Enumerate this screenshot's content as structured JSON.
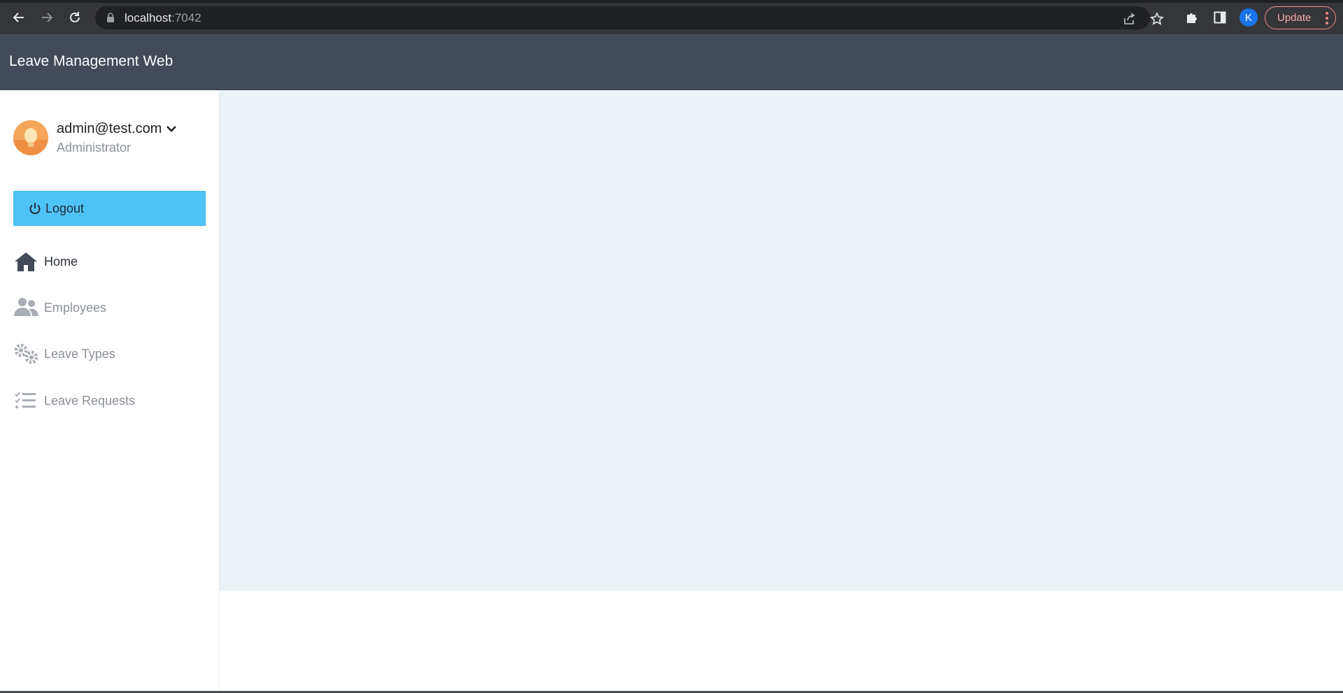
{
  "browser": {
    "url_host": "localhost",
    "url_port": ":7042",
    "profile_initial": "K",
    "update_label": "Update"
  },
  "app": {
    "title": "Leave Management Web"
  },
  "user": {
    "email": "admin@test.com",
    "role": "Administrator"
  },
  "sidebar": {
    "logout_label": "Logout",
    "items": [
      {
        "label": "Home",
        "icon": "home-icon",
        "active": true
      },
      {
        "label": "Employees",
        "icon": "users-icon",
        "active": false
      },
      {
        "label": "Leave Types",
        "icon": "gears-icon",
        "active": false
      },
      {
        "label": "Leave Requests",
        "icon": "list-check-icon",
        "active": false
      }
    ]
  },
  "colors": {
    "header_bg": "#434a58",
    "logout_bg": "#4fc3f7",
    "main_bg": "#ebf3f7",
    "browser_bg": "#35363a"
  }
}
